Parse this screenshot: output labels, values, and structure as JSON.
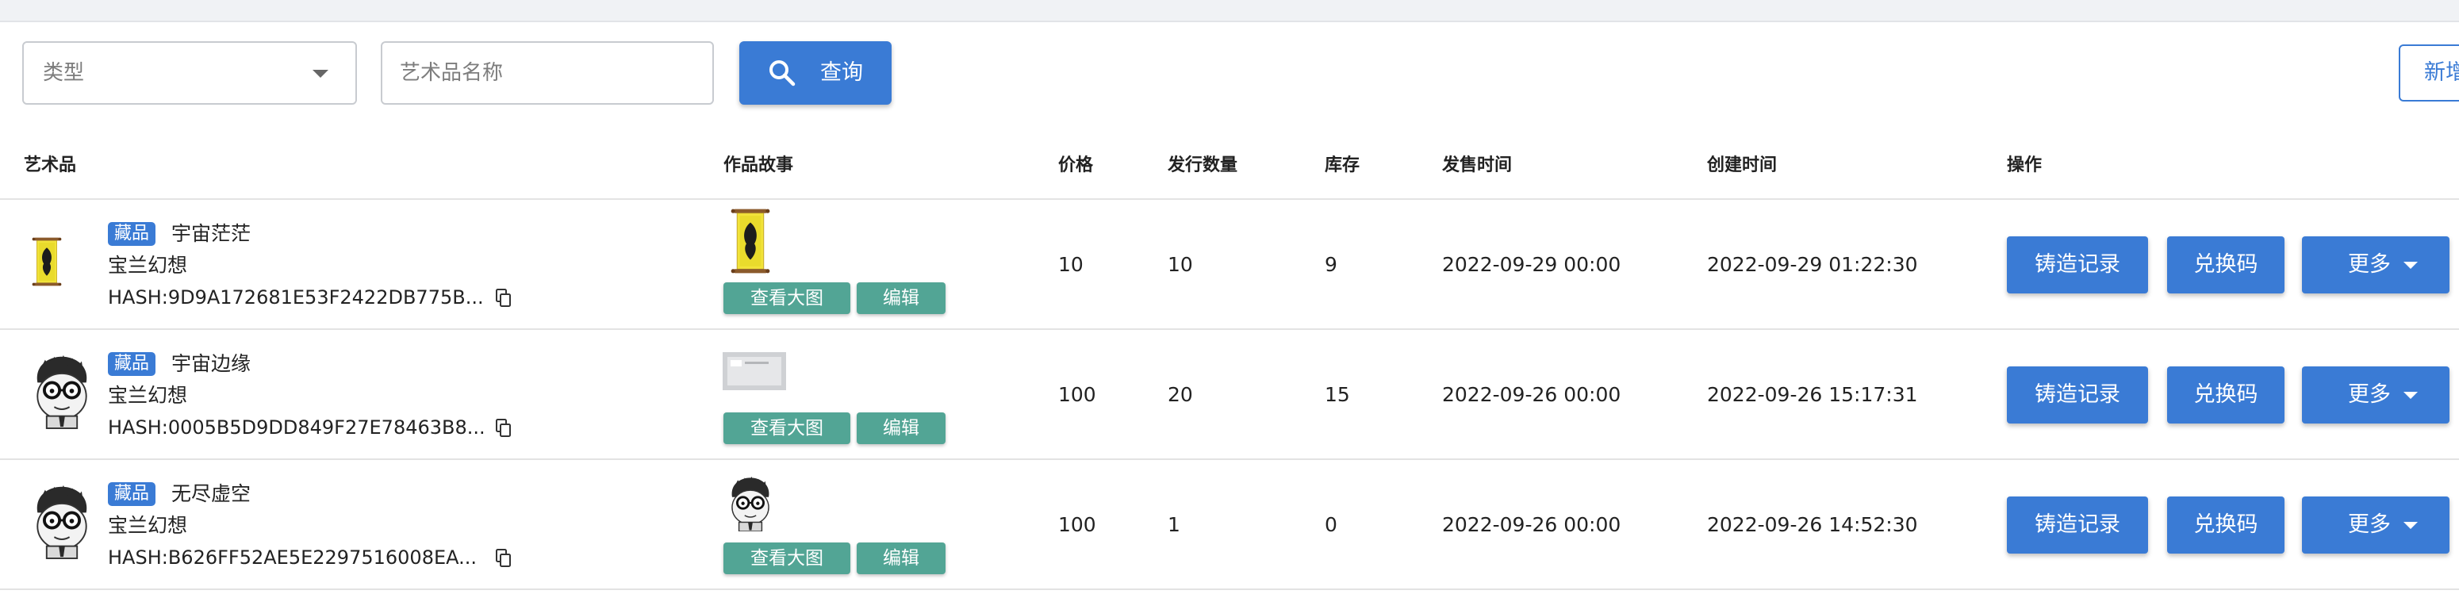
{
  "filters": {
    "type_placeholder": "类型",
    "name_placeholder": "艺术品名称",
    "search_label": "查询",
    "add_label": "新增"
  },
  "table": {
    "headers": {
      "artwork": "艺术品",
      "story": "作品故事",
      "price": "价格",
      "issue_qty": "发行数量",
      "stock": "库存",
      "sale_time": "发售时间",
      "create_time": "创建时间",
      "actions": "操作"
    },
    "story_buttons": {
      "view": "查看大图",
      "edit": "编辑"
    },
    "action_buttons": {
      "mint": "铸造记录",
      "redeem": "兑换码",
      "more": "更多"
    },
    "rows": [
      {
        "tag": "藏品",
        "name": "宇宙茫茫",
        "series": "宝兰幻想",
        "hash": "HASH:9D9A172681E53F2422DB775B...",
        "thumb": "scroll-painting-icon",
        "story_thumb": "scroll-painting-icon",
        "price": "10",
        "issue_qty": "10",
        "stock": "9",
        "sale_time": "2022-09-29 00:00",
        "create_time": "2022-09-29 01:22:30"
      },
      {
        "tag": "藏品",
        "name": "宇宙边缘",
        "series": "宝兰幻想",
        "hash": "HASH:0005B5D9DD849F27E78463B8...",
        "thumb": "cartoon-avatar-icon",
        "story_thumb": "document-screenshot-icon",
        "price": "100",
        "issue_qty": "20",
        "stock": "15",
        "sale_time": "2022-09-26 00:00",
        "create_time": "2022-09-26 15:17:31"
      },
      {
        "tag": "藏品",
        "name": "无尽虚空",
        "series": "宝兰幻想",
        "hash": "HASH:B626FF52AE5E2297516008EA...",
        "thumb": "cartoon-avatar-icon",
        "story_thumb": "cartoon-avatar-icon",
        "price": "100",
        "issue_qty": "1",
        "stock": "0",
        "sale_time": "2022-09-26 00:00",
        "create_time": "2022-09-26 14:52:30"
      }
    ]
  },
  "colors": {
    "primary": "#3a7bd5",
    "teal_button": "#52a595",
    "border": "#c8cbd0",
    "row_divider": "#e3e3e3"
  }
}
